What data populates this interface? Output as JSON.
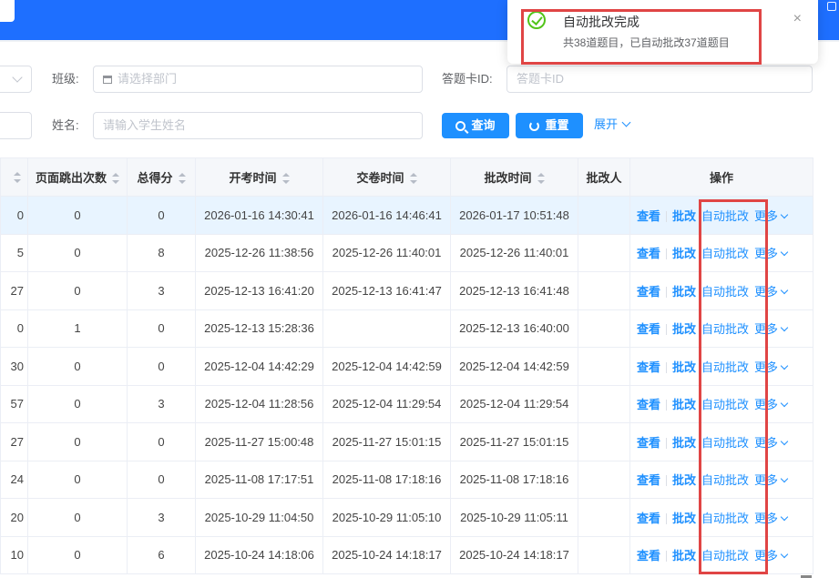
{
  "filters": {
    "class_label": "班级:",
    "class_placeholder": "请选择部门",
    "card_label": "答题卡ID:",
    "card_placeholder": "答题卡ID",
    "name_label": "姓名:",
    "name_placeholder": "请输入学生姓名",
    "search_btn": "查询",
    "reset_btn": "重置",
    "expand_link": "展开"
  },
  "table": {
    "columns": [
      "",
      "页面跳出次数",
      "总得分",
      "开考时间",
      "交卷时间",
      "批改时间",
      "批改人",
      "操作"
    ],
    "rows": [
      {
        "c0": "0",
        "jumps": "0",
        "score": "0",
        "start": "2026-01-16 14:30:41",
        "submit": "2026-01-16 14:46:41",
        "graded": "2026-01-17 10:51:48",
        "grader": ""
      },
      {
        "c0": "5",
        "jumps": "0",
        "score": "8",
        "start": "2025-12-26 11:38:56",
        "submit": "2025-12-26 11:40:01",
        "graded": "2025-12-26 11:40:01",
        "grader": ""
      },
      {
        "c0": "27",
        "jumps": "0",
        "score": "3",
        "start": "2025-12-13 16:41:20",
        "submit": "2025-12-13 16:41:47",
        "graded": "2025-12-13 16:41:48",
        "grader": ""
      },
      {
        "c0": "0",
        "jumps": "1",
        "score": "0",
        "start": "2025-12-13 15:28:36",
        "submit": "",
        "graded": "2025-12-13 16:40:00",
        "grader": ""
      },
      {
        "c0": "30",
        "jumps": "0",
        "score": "0",
        "start": "2025-12-04 14:42:29",
        "submit": "2025-12-04 14:42:59",
        "graded": "2025-12-04 14:42:59",
        "grader": ""
      },
      {
        "c0": "57",
        "jumps": "0",
        "score": "3",
        "start": "2025-12-04 11:28:56",
        "submit": "2025-12-04 11:29:54",
        "graded": "2025-12-04 11:29:54",
        "grader": ""
      },
      {
        "c0": "27",
        "jumps": "0",
        "score": "0",
        "start": "2025-11-27 15:00:48",
        "submit": "2025-11-27 15:01:15",
        "graded": "2025-11-27 15:01:15",
        "grader": ""
      },
      {
        "c0": "24",
        "jumps": "0",
        "score": "0",
        "start": "2025-11-08 17:17:51",
        "submit": "2025-11-08 17:18:16",
        "graded": "2025-11-08 17:18:16",
        "grader": ""
      },
      {
        "c0": "20",
        "jumps": "0",
        "score": "3",
        "start": "2025-10-29 11:04:50",
        "submit": "2025-10-29 11:05:10",
        "graded": "2025-10-29 11:05:11",
        "grader": ""
      },
      {
        "c0": "10",
        "jumps": "0",
        "score": "6",
        "start": "2025-10-24 14:18:06",
        "submit": "2025-10-24 14:18:17",
        "graded": "2025-10-24 14:18:17",
        "grader": ""
      }
    ],
    "actions": {
      "view": "查看",
      "grade": "批改",
      "auto": "自动批改",
      "more": "更多"
    }
  },
  "toast": {
    "title": "自动批改完成",
    "message": "共38道题目，已自动批改37道题目",
    "close": "×"
  },
  "colors": {
    "accent": "#1e90ff",
    "header": "#1e6fff",
    "highlight": "#e04545",
    "success": "#52c41a"
  }
}
